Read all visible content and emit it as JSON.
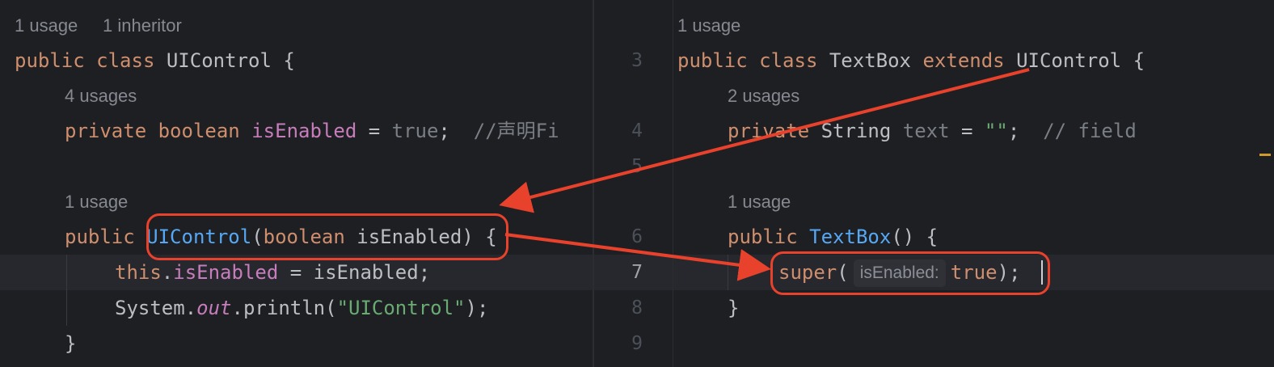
{
  "left": {
    "hint_usage": "1 usage",
    "hint_inheritor": "1 inheritor",
    "l1": {
      "kw1": "public",
      "kw2": "class",
      "name": "UIControl",
      "brace": "{"
    },
    "hint_4usages": "4 usages",
    "l2": {
      "kw1": "private",
      "kw2": "boolean",
      "field": "isEnabled",
      "eq": "=",
      "val": "true",
      "semi": ";",
      "comment": "//声明Fi"
    },
    "hint_1usage": "1 usage",
    "l3": {
      "kw1": "public",
      "name": "UIControl",
      "open": "(",
      "type": "boolean",
      "param": "isEnabled",
      "close": ")",
      "brace": "{"
    },
    "l4": {
      "this": "this",
      "dot": ".",
      "field": "isEnabled",
      "rest": " = isEnabled;"
    },
    "l5": {
      "sys": "System.",
      "out": "out",
      "call": ".println(",
      "str": "\"UIControl\"",
      "end": ");"
    },
    "l6": {
      "brace": "}"
    }
  },
  "right": {
    "hint_usage": "1 usage",
    "line_numbers": [
      "3",
      "4",
      "5",
      "6",
      "7",
      "8",
      "9"
    ],
    "current_line": "7",
    "l1": {
      "kw1": "public",
      "kw2": "class",
      "name": "TextBox",
      "kw3": "extends",
      "parent": "UIControl",
      "brace": "{"
    },
    "hint_2usages": "2 usages",
    "l2": {
      "kw1": "private",
      "type": "String",
      "field": "text",
      "eq": "=",
      "str": "\"\"",
      "semi": ";",
      "comment": "// field"
    },
    "hint_1usage": "1 usage",
    "l3": {
      "kw1": "public",
      "name": "TextBox",
      "rest": "() {"
    },
    "l4": {
      "kw": "super",
      "open": "(",
      "inlay": "isEnabled:",
      "val": "true",
      "end": ");"
    },
    "l5": {
      "brace": "}"
    }
  },
  "colors": {
    "background": "#1e1f22",
    "keyword": "#cf8e6d",
    "field": "#c77dbb",
    "function": "#56a8f5",
    "string": "#6aab73",
    "annotation_red": "#e8412c"
  }
}
